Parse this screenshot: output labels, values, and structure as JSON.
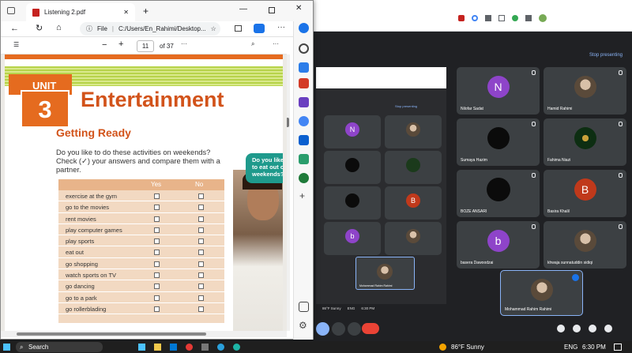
{
  "chrome": {
    "weather": "86°F Sunny",
    "lang": "ENG",
    "time": "6:30 PM"
  },
  "meet": {
    "stop_presenting": "Stop presenting",
    "participants": [
      {
        "name": "Nilofar Sadat",
        "initial": "N",
        "color": "#8e44c9",
        "type": "initial"
      },
      {
        "name": "Hamid Rahimi",
        "initial": "",
        "color": "",
        "type": "photo"
      },
      {
        "name": "Sumaya Hazim",
        "initial": "",
        "color": "",
        "type": "photo"
      },
      {
        "name": "Fahima Niazi",
        "initial": "",
        "color": "",
        "type": "photo"
      },
      {
        "name": "BOZE ANSARI",
        "initial": "",
        "color": "",
        "type": "dark"
      },
      {
        "name": "Basira Khalil",
        "initial": "B",
        "color": "#c0391b",
        "type": "initial"
      },
      {
        "name": "basera Dawoodzai",
        "initial": "b",
        "color": "#8e44c9",
        "type": "initial"
      },
      {
        "name": "khwaja sunnatuddin sidiqi",
        "initial": "",
        "color": "",
        "type": "photo"
      }
    ],
    "self": {
      "name": "Mohammad Rahim Rahimi"
    },
    "inner_self": "Mohammad Rahim Rahimi",
    "inner_weather": "86°F Sunny",
    "inner_lang": "ENG",
    "inner_time": "6:30 PM"
  },
  "pdf": {
    "tab_title": "Listening 2.pdf",
    "url_prefix": "File",
    "url": "C:/Users/En_Rahimi/Desktop...",
    "page_current": "11",
    "page_total": "of 37",
    "unit_label": "UNIT",
    "unit_number": "3",
    "heading": "Entertainment",
    "subheading": "Getting Ready",
    "intro": "Do you like to do these activities on weekends? Check (✓) your answers and compare them with a partner.",
    "col_yes": "Yes",
    "col_no": "No",
    "activities": [
      "exercise at the gym",
      "go to the movies",
      "rent movies",
      "play computer games",
      "play sports",
      "eat out",
      "go shopping",
      "watch sports on TV",
      "go dancing",
      "go to a park",
      "go rollerblading"
    ],
    "bubble": "Do you like to eat out on weekends?"
  },
  "taskbar": {
    "search": "Search",
    "weather": "86°F Sunny",
    "lang": "ENG",
    "time": "6:30 PM"
  }
}
